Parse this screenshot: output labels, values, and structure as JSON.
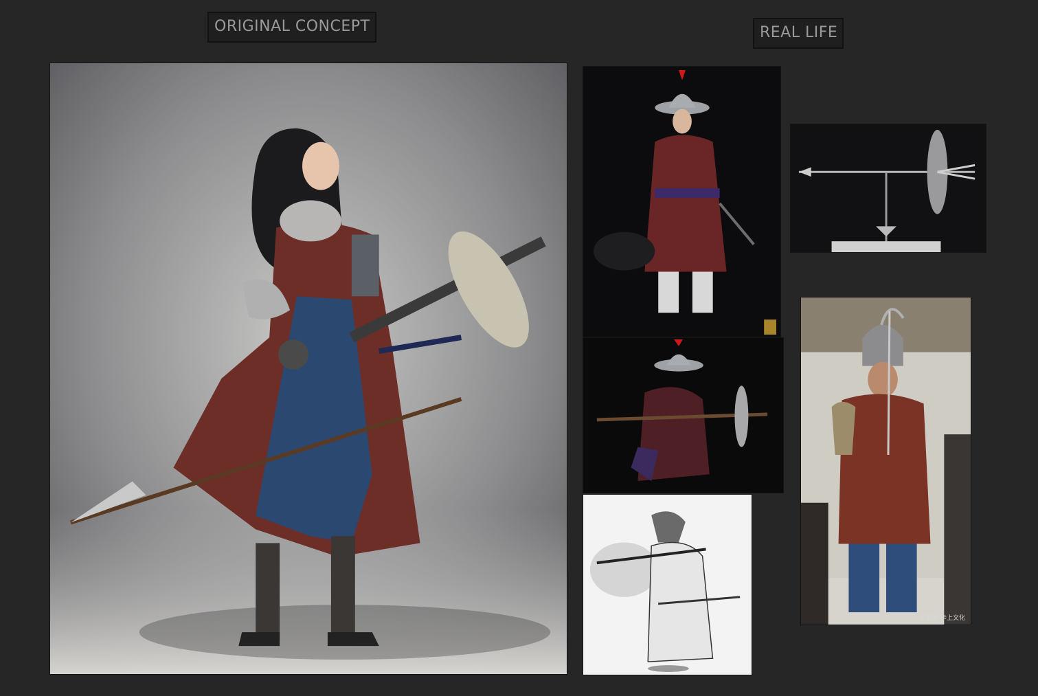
{
  "header": {
    "left_label": "ORIGINAL CONCEPT",
    "right_label": "REAL LIFE"
  },
  "images": {
    "concept": {
      "subject": "female-warrior-concept-art"
    },
    "figure_standing": {
      "subject": "action-figure-standing"
    },
    "gun_shield": {
      "subject": "shield-gun-weapon-model"
    },
    "figure_kneeling": {
      "subject": "action-figure-kneeling"
    },
    "sketch": {
      "subject": "ink-sketch-soldier"
    },
    "cosplay": {
      "subject": "armored-man-photo",
      "watermark": "李曼墨·卡上文化"
    }
  },
  "colors": {
    "page_bg": "#262626",
    "label_bg": "#1f1f1f",
    "label_text": "#9a9a9a"
  }
}
